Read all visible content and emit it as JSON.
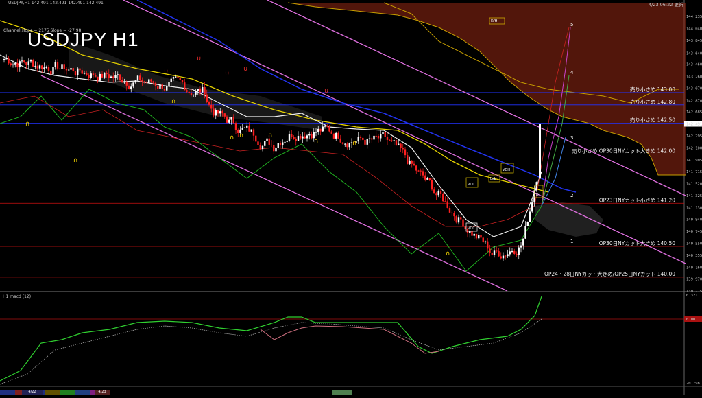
{
  "header": {
    "symbol_line": "USDJPY,H1  142.491 142.491 142.491 142.491",
    "indicator_line": "Channel slope = 2175  Slope = -27.98",
    "big_title": "USDJPY H1",
    "update_stamp": "4/23 06:22 更新",
    "macd_label": "H1  macd (12)"
  },
  "chart_data": {
    "type": "candlestick",
    "ylim": [
      139.775,
      144.46
    ],
    "y_ticks": [
      144.235,
      144.04,
      143.845,
      143.64,
      143.46,
      143.26,
      143.07,
      142.87,
      142.685,
      142.491,
      142.295,
      142.1,
      141.905,
      141.715,
      141.52,
      141.325,
      141.13,
      140.94,
      140.745,
      140.55,
      140.355,
      140.16,
      139.97,
      139.775
    ],
    "current_price": 142.491,
    "date_labels": [
      "4/22",
      "4/23"
    ],
    "levels": [
      {
        "label": "売り小さめ 143.00",
        "price": 143.0,
        "color": "#2233ff"
      },
      {
        "label": "売り小さめ 142.80",
        "price": 142.8,
        "color": "#2233ff"
      },
      {
        "label": "売り小さめ 142.50",
        "price": 142.5,
        "color": "#2233ff"
      },
      {
        "label": "売り小さめ  OP30日NYカット大きめ 142.00",
        "price": 142.0,
        "color": "#2233ff"
      },
      {
        "label": "OP23日NYカット小さめ 141.20",
        "price": 141.2,
        "color": "#cc1111"
      },
      {
        "label": "OP30日NYカット大きめ 140.50",
        "price": 140.5,
        "color": "#cc1111"
      },
      {
        "label": "OP24・28日NYカット大きめ/OP25日NYカット 140.00",
        "price": 140.0,
        "color": "#cc1111"
      }
    ],
    "wave_labels": [
      "5",
      "4",
      "3",
      "2",
      "1"
    ],
    "boxes": [
      "LVH",
      "VDH",
      "VDC",
      "LVL",
      "VDC",
      "D"
    ],
    "macd": {
      "top": "0.321",
      "zero": "0.00",
      "bottom": "-0.798"
    }
  },
  "footer": {
    "tab_4_22": "4/22",
    "tab_4_23": "4/23"
  }
}
